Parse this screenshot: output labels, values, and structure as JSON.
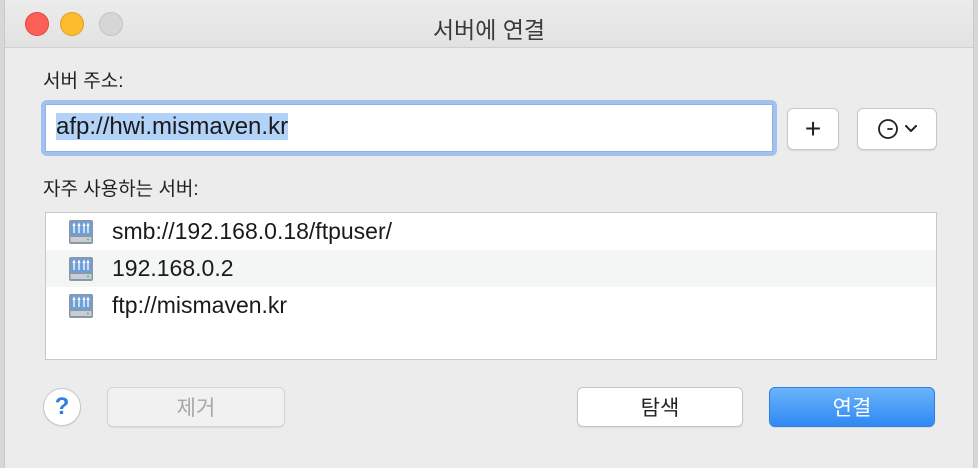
{
  "window": {
    "title": "서버에 연결"
  },
  "server_address": {
    "label": "서버 주소:",
    "value": "afp://hwi.mismaven.kr"
  },
  "buttons": {
    "add": "+",
    "help": "?",
    "remove": "제거",
    "browse": "탐색",
    "connect": "연결"
  },
  "favorites": {
    "label": "자주 사용하는 서버:",
    "items": [
      {
        "address": "smb://192.168.0.18/ftpuser/",
        "icon": "server-icon"
      },
      {
        "address": "192.168.0.2",
        "icon": "server-icon"
      },
      {
        "address": "ftp://mismaven.kr",
        "icon": "server-icon"
      }
    ]
  },
  "colors": {
    "accent": "#2e89f4",
    "close": "#fc5f57",
    "minimize": "#fdbc2e",
    "zoom_disabled": "#d6d6d6",
    "selection": "#b3d2f8"
  }
}
